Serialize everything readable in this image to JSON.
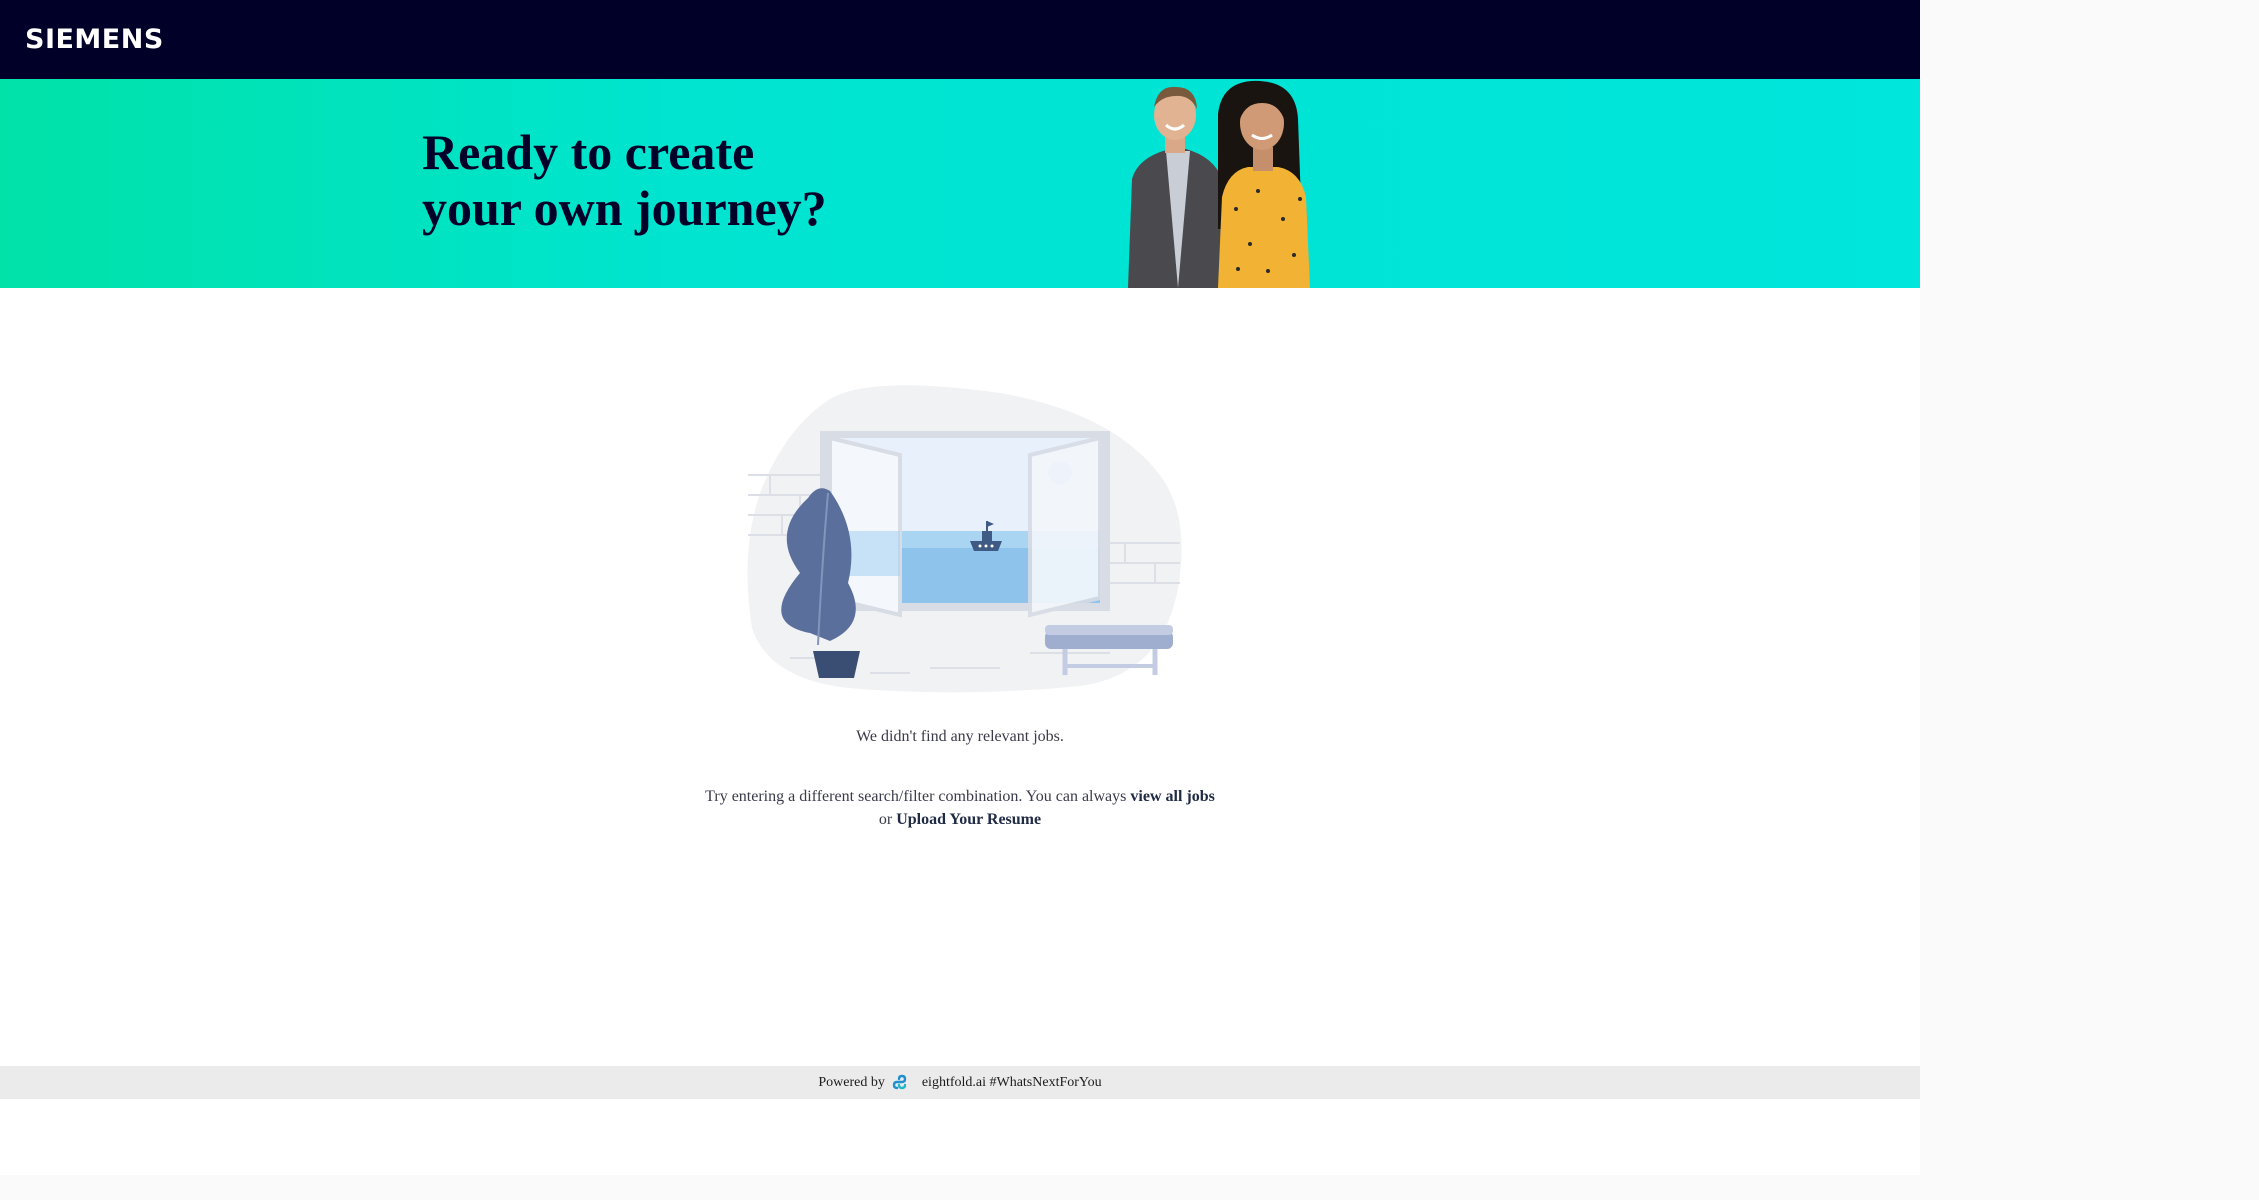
{
  "header": {
    "logo_text": "SIEMENS",
    "bg_color": "#000028"
  },
  "banner": {
    "title_line1": "Ready to create",
    "title_line2": "your own journey?",
    "image": "two-smiling-people-photo",
    "accent_color": "#00e5dc"
  },
  "empty_state": {
    "illustration": "empty-room-window-sea-illustration",
    "message": "We didn't find any relevant jobs.",
    "hint_prefix": "Try entering a different search/filter combination. You can always",
    "view_all_link": "view all jobs",
    "hint_or": "or",
    "upload_link": "Upload Your Resume"
  },
  "footer": {
    "powered_by": "Powered by",
    "brand_icon": "eightfold-logo-icon",
    "brand_text": "eightfold.ai #WhatsNextForYou"
  }
}
